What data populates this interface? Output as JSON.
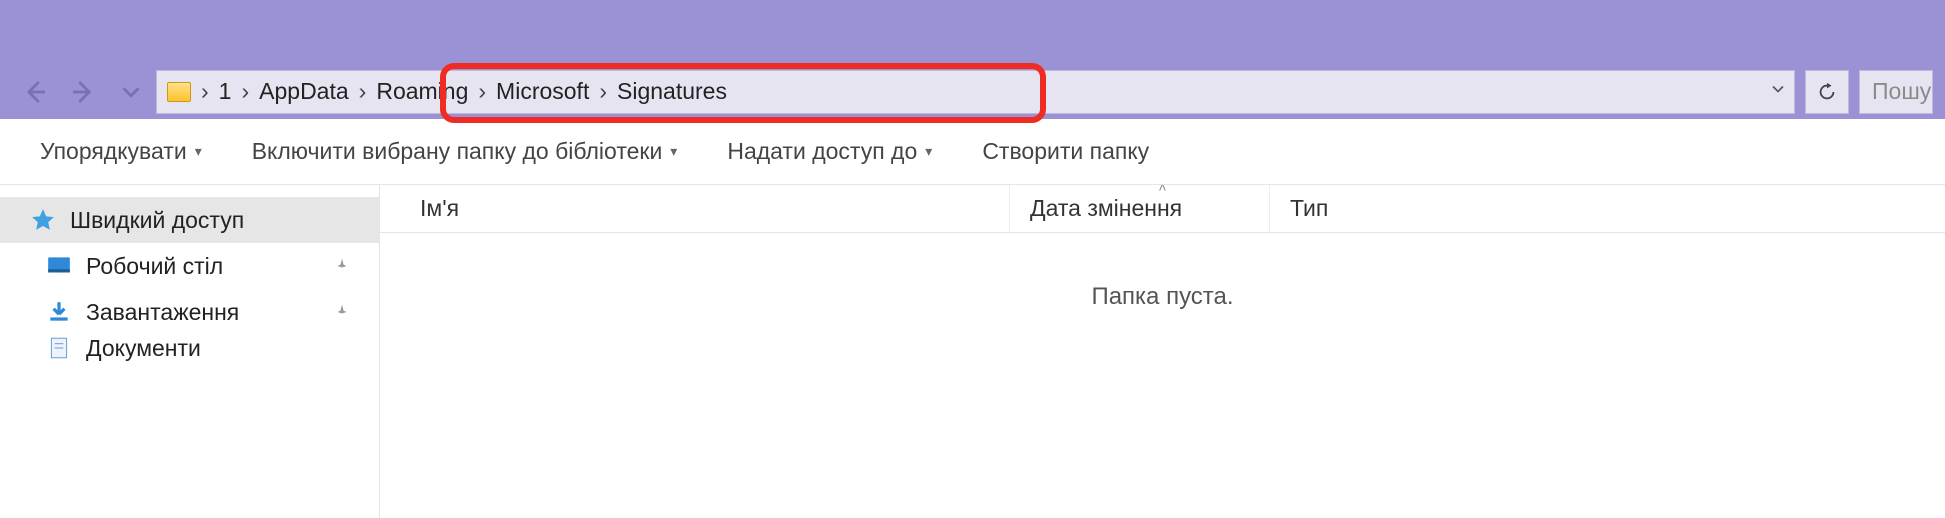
{
  "breadcrumb": {
    "root": "1",
    "items": [
      "AppData",
      "Roaming",
      "Microsoft",
      "Signatures"
    ]
  },
  "search": {
    "placeholder": "Пошу"
  },
  "commands": {
    "organize": "Упорядкувати",
    "include_lib": "Включити вибрану папку до бібліотеки",
    "share": "Надати доступ до",
    "new_folder": "Створити папку"
  },
  "columns": {
    "name": "Ім'я",
    "date": "Дата змінення",
    "type": "Тип"
  },
  "empty_text": "Папка пуста.",
  "nav": {
    "quick_access": "Швидкий доступ",
    "desktop": "Робочий стіл",
    "downloads": "Завантаження",
    "documents": "Документи"
  }
}
